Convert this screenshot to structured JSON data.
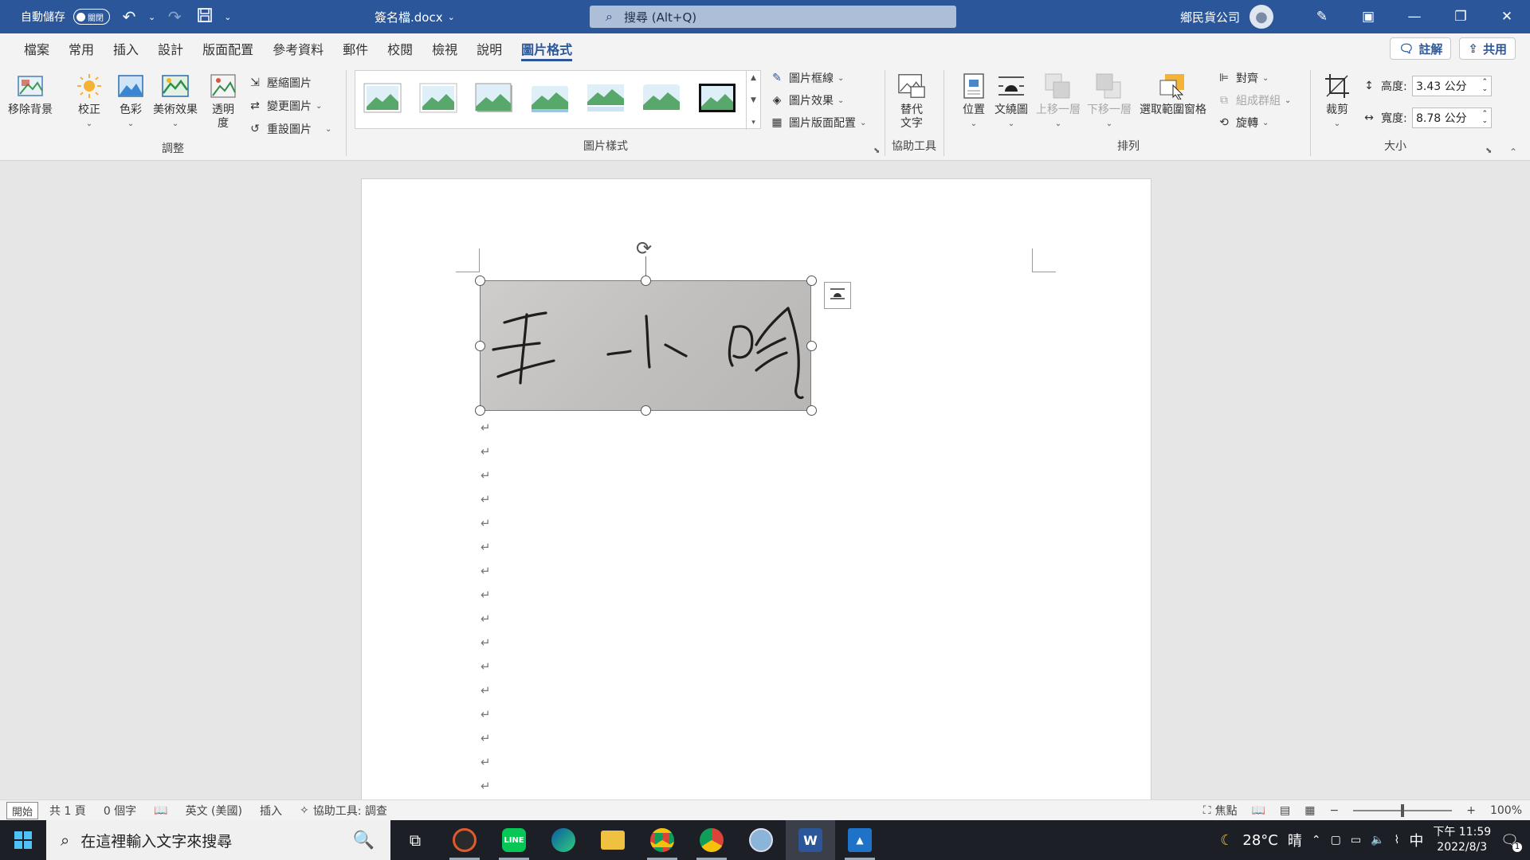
{
  "titlebar": {
    "autosave_label": "自動儲存",
    "autosave_state": "關閉",
    "filename": "簽名檔.docx",
    "search_placeholder": "搜尋 (Alt+Q)",
    "account_name": "鄉民貨公司"
  },
  "tabs": [
    "檔案",
    "常用",
    "插入",
    "設計",
    "版面配置",
    "參考資料",
    "郵件",
    "校閱",
    "檢視",
    "說明",
    "圖片格式"
  ],
  "active_tab": "圖片格式",
  "tab_actions": {
    "comments": "註解",
    "share": "共用"
  },
  "ribbon": {
    "adjust": {
      "remove_bg": "移除背景",
      "corrections": "校正",
      "color": "色彩",
      "artistic": "美術效果",
      "transparency_l1": "透明",
      "transparency_l2": "度",
      "compress": "壓縮圖片",
      "change": "變更圖片",
      "reset": "重設圖片",
      "label": "調整"
    },
    "styles": {
      "border": "圖片框線",
      "effects": "圖片效果",
      "layout": "圖片版面配置",
      "label": "圖片樣式"
    },
    "accessibility": {
      "alt_text_l1": "替代",
      "alt_text_l2": "文字",
      "label": "協助工具"
    },
    "arrange": {
      "position": "位置",
      "wrap": "文繞圖",
      "bring_forward": "上移一層",
      "send_backward": "下移一層",
      "selection_pane": "選取範圍窗格",
      "align": "對齊",
      "group": "組成群組",
      "rotate": "旋轉",
      "label": "排列"
    },
    "size": {
      "crop": "裁剪",
      "height_label": "高度:",
      "height_value": "3.43 公分",
      "width_label": "寬度:",
      "width_value": "8.78 公分",
      "label": "大小"
    }
  },
  "status": {
    "tooltip": "開始",
    "pages": "共 1 頁",
    "words": "0 個字",
    "language": "英文 (美國)",
    "mode": "插入",
    "accessibility": "協助工具: 調查",
    "focus": "焦點",
    "zoom": "100%"
  },
  "taskbar": {
    "search_placeholder": "在這裡輸入文字來搜尋",
    "temperature": "28°C",
    "weather": "晴",
    "ime": "中",
    "time": "下午 11:59",
    "date": "2022/8/3",
    "notification_count": "1"
  },
  "colors": {
    "word_blue": "#2b579a",
    "ribbon_bg": "#f3f3f3",
    "taskbar_bg": "#1c1f26"
  }
}
